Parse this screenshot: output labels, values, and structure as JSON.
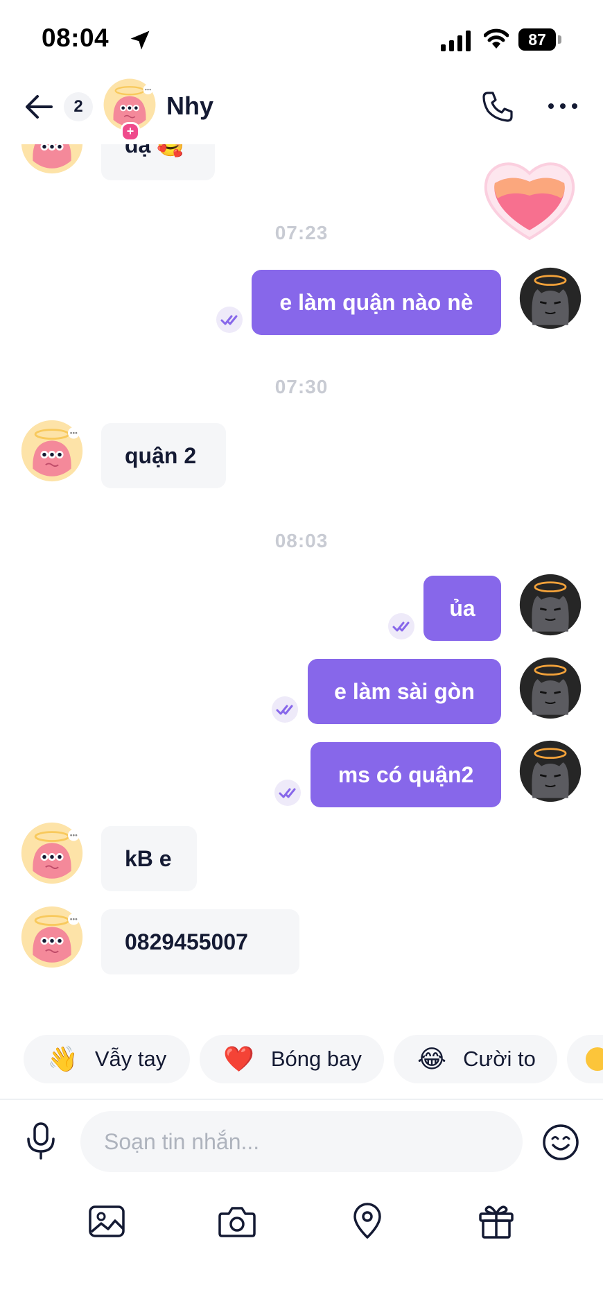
{
  "status_bar": {
    "time": "08:04",
    "battery": "87"
  },
  "header": {
    "unread_count": "2",
    "contact_name": "Nhy"
  },
  "messages": [
    {
      "text": "dạ 🥰"
    },
    {
      "timestamp": "07:23"
    },
    {
      "text": "e làm quận nào nè"
    },
    {
      "timestamp": "07:30"
    },
    {
      "text": "quận 2"
    },
    {
      "timestamp": "08:03"
    },
    {
      "text": "ủa"
    },
    {
      "text": "e làm sài gòn"
    },
    {
      "text": "ms có quận2"
    },
    {
      "text": "kB e"
    },
    {
      "text": "0829455007"
    }
  ],
  "quick_reactions": [
    {
      "emoji": "👋",
      "label": "Vẫy tay"
    },
    {
      "emoji": "❤️",
      "label": "Bóng bay"
    },
    {
      "emoji": "😂",
      "label": "Cười to"
    }
  ],
  "composer": {
    "placeholder": "Soạn tin nhắn..."
  },
  "colors": {
    "accent": "#8767ea",
    "incoming_bubble": "#f5f6f8",
    "text": "#141a33",
    "timestamp": "#c8cbd3"
  }
}
